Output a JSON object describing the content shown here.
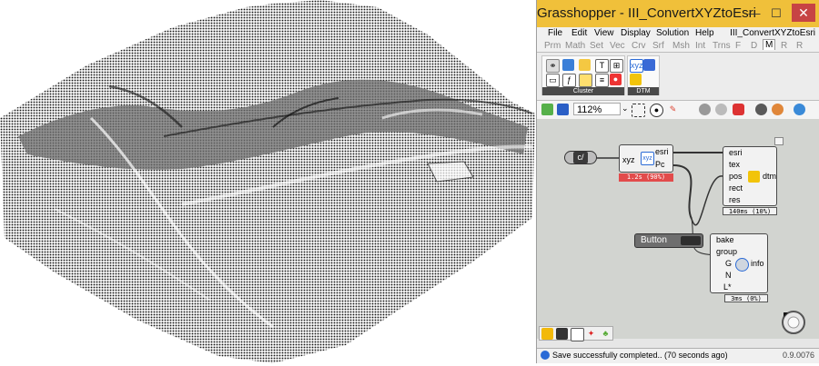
{
  "window": {
    "title": "Grasshopper - III_ConvertXYZtoEsri",
    "minimize": "—",
    "maximize": "☐",
    "close": "✕"
  },
  "menu": {
    "items": [
      "File",
      "Edit",
      "View",
      "Display",
      "Solution",
      "Help"
    ],
    "document": "III_ConvertXYZtoEsri"
  },
  "tabs": [
    "Prm",
    "Math",
    "Set",
    "Vec",
    "Crv",
    "Srf",
    "Msh",
    "Int",
    "Trns",
    "F",
    "D",
    "M",
    "R",
    "R"
  ],
  "active_tab": "M",
  "ribbon": {
    "group1": "Cluster",
    "group2": "DTM"
  },
  "toolbar": {
    "zoom": "112%"
  },
  "canvas": {
    "panel_label": "c/",
    "conv": {
      "input": "xyz",
      "outputs": [
        "esri",
        "Pc"
      ],
      "timer": "1.2s (90%)"
    },
    "dtm": {
      "inputs": [
        "esri",
        "tex",
        "pos",
        "rect",
        "res"
      ],
      "output": "dtm",
      "timer": "140ms (10%)"
    },
    "button": {
      "label": "Button"
    },
    "bake": {
      "inputs": [
        "bake",
        "group",
        "G",
        "N",
        "L*"
      ],
      "output": "info",
      "timer": "3ms (0%)"
    }
  },
  "status": {
    "message": "Save successfully completed.. (70 seconds ago)",
    "version": "0.9.0076"
  },
  "colors": {
    "titlebar": "#f0c03a",
    "canvas": "#d2d4d0",
    "error_timer": "#e24b4b",
    "accent": "#2a6ad6"
  }
}
